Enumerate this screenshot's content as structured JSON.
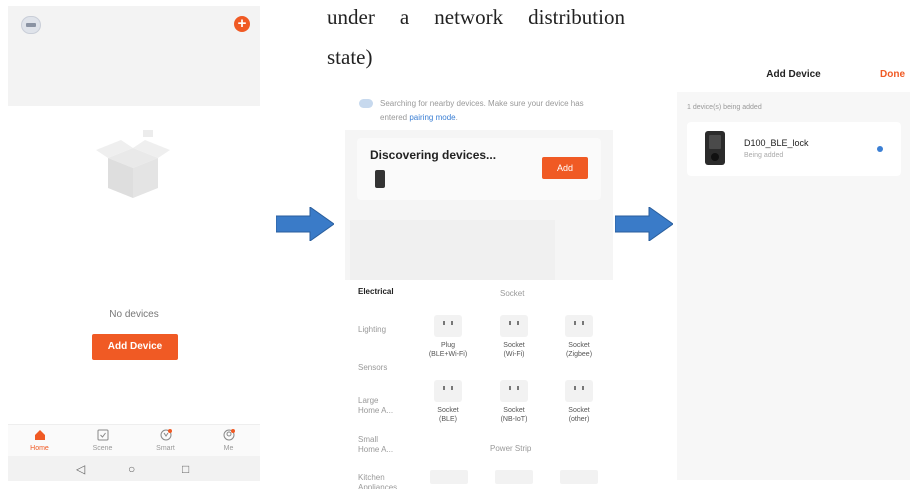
{
  "document": {
    "line1_words": [
      "under",
      "a",
      "network",
      "distribution"
    ],
    "line2": "state)"
  },
  "home_screen": {
    "empty_text": "No devices",
    "add_button": "Add Device",
    "tabs": [
      {
        "label": "Home",
        "icon": "home-icon",
        "active": true
      },
      {
        "label": "Scene",
        "icon": "scene-icon",
        "active": false
      },
      {
        "label": "Smart",
        "icon": "smart-icon",
        "active": false
      },
      {
        "label": "Me",
        "icon": "me-icon",
        "active": false
      }
    ],
    "accent": "#f05a24"
  },
  "discover_screen": {
    "search_text": "Searching for nearby devices. Make sure your device has entered ",
    "search_link": "pairing mode",
    "search_end": ".",
    "discovering_title": "Discovering devices...",
    "add_button": "Add",
    "categories": [
      "Electrical",
      "Lighting",
      "Sensors",
      "Large\nHome A...",
      "Small\nHome A...",
      "Kitchen\nAppliances"
    ],
    "socket_section": "Socket",
    "power_strip_section": "Power Strip",
    "devices": [
      {
        "label": "Plug\n(BLE+Wi-Fi)"
      },
      {
        "label": "Socket\n(Wi-Fi)"
      },
      {
        "label": "Socket\n(Zigbee)"
      },
      {
        "label": "Socket\n(BLE)"
      },
      {
        "label": "Socket\n(NB-IoT)"
      },
      {
        "label": "Socket\n(other)"
      }
    ]
  },
  "adding_screen": {
    "title": "Add Device",
    "done": "Done",
    "count_text": "1 device(s) being added",
    "device_name": "D100_BLE_lock",
    "device_status": "Being added",
    "spinner_color": "#3b7fd4"
  },
  "arrow_color": "#3a7bc8"
}
